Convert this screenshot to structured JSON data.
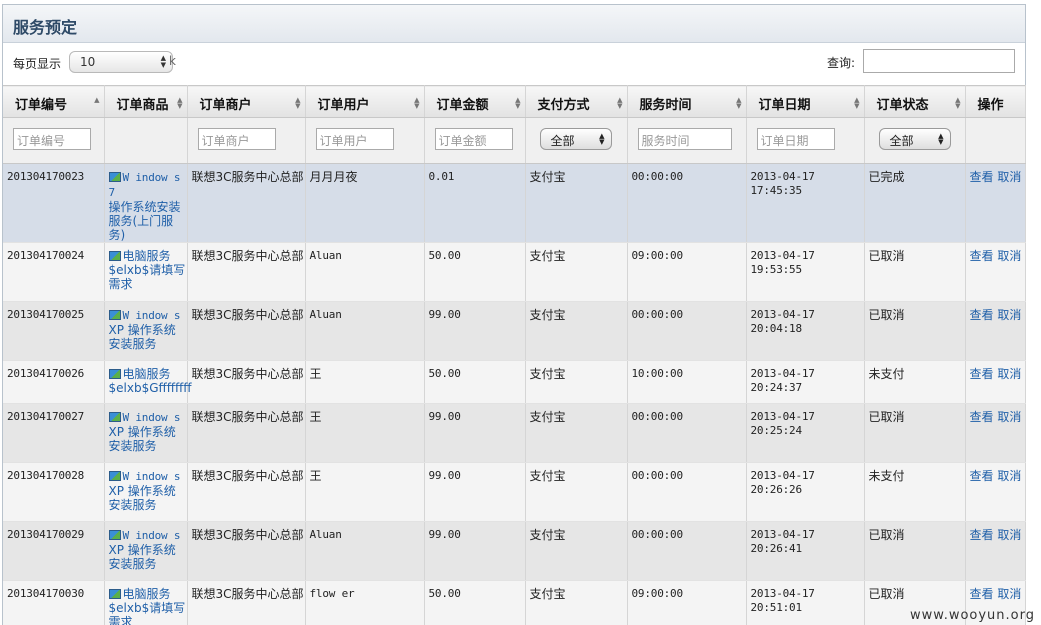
{
  "title": "服务预定",
  "toolbar": {
    "length_label": "每页显示",
    "length_value": "10",
    "length_suffix": "k",
    "search_label": "查询:"
  },
  "columns": [
    {
      "label": "订单编号",
      "filter_placeholder": "订单编号",
      "filter_type": "input"
    },
    {
      "label": "订单商品",
      "filter_placeholder": "",
      "filter_type": "none"
    },
    {
      "label": "订单商户",
      "filter_placeholder": "订单商户",
      "filter_type": "input"
    },
    {
      "label": "订单用户",
      "filter_placeholder": "订单用户",
      "filter_type": "input"
    },
    {
      "label": "订单金额",
      "filter_placeholder": "订单金额",
      "filter_type": "input"
    },
    {
      "label": "支付方式",
      "filter_placeholder": "全部",
      "filter_type": "select"
    },
    {
      "label": "服务时间",
      "filter_placeholder": "服务时间",
      "filter_type": "input"
    },
    {
      "label": "订单日期",
      "filter_placeholder": "订单日期",
      "filter_type": "input"
    },
    {
      "label": "订单状态",
      "filter_placeholder": "全部",
      "filter_type": "select"
    },
    {
      "label": "操作",
      "filter_placeholder": "",
      "filter_type": "none"
    }
  ],
  "rows": [
    {
      "id": "201304170023",
      "product_line1": "W indow s 7",
      "product_rest": "操作系统安装服务(上门服务)",
      "merchant": "联想3C服务中心总部",
      "user": "月月月夜",
      "amount": "0.01",
      "payment": "支付宝",
      "service_time": "00:00:00",
      "date": "2013-04-17",
      "time": "17:45:35",
      "status": "已完成",
      "view": "查看",
      "cancel": "取消"
    },
    {
      "id": "201304170024",
      "product_line1": "电脑服务",
      "product_rest": "$elxb$请填写需求",
      "merchant": "联想3C服务中心总部",
      "user": "Aluan",
      "amount": "50.00",
      "payment": "支付宝",
      "service_time": "09:00:00",
      "date": "2013-04-17",
      "time": "19:53:55",
      "status": "已取消",
      "view": "查看",
      "cancel": "取消"
    },
    {
      "id": "201304170025",
      "product_line1": "W indow s",
      "product_rest": "XP 操作系统安装服务",
      "merchant": "联想3C服务中心总部",
      "user": "Aluan",
      "amount": "99.00",
      "payment": "支付宝",
      "service_time": "00:00:00",
      "date": "2013-04-17",
      "time": "20:04:18",
      "status": "已取消",
      "view": "查看",
      "cancel": "取消"
    },
    {
      "id": "201304170026",
      "product_line1": "电脑服务",
      "product_rest": "$elxb$Gffffffff",
      "merchant": "联想3C服务中心总部",
      "user": "王",
      "amount": "50.00",
      "payment": "支付宝",
      "service_time": "10:00:00",
      "date": "2013-04-17",
      "time": "20:24:37",
      "status": "未支付",
      "view": "查看",
      "cancel": "取消"
    },
    {
      "id": "201304170027",
      "product_line1": "W indow s",
      "product_rest": "XP 操作系统安装服务",
      "merchant": "联想3C服务中心总部",
      "user": "王",
      "amount": "99.00",
      "payment": "支付宝",
      "service_time": "00:00:00",
      "date": "2013-04-17",
      "time": "20:25:24",
      "status": "已取消",
      "view": "查看",
      "cancel": "取消"
    },
    {
      "id": "201304170028",
      "product_line1": "W indow s",
      "product_rest": "XP 操作系统安装服务",
      "merchant": "联想3C服务中心总部",
      "user": "王",
      "amount": "99.00",
      "payment": "支付宝",
      "service_time": "00:00:00",
      "date": "2013-04-17",
      "time": "20:26:26",
      "status": "未支付",
      "view": "查看",
      "cancel": "取消"
    },
    {
      "id": "201304170029",
      "product_line1": "W indow s",
      "product_rest": "XP 操作系统安装服务",
      "merchant": "联想3C服务中心总部",
      "user": "Aluan",
      "amount": "99.00",
      "payment": "支付宝",
      "service_time": "00:00:00",
      "date": "2013-04-17",
      "time": "20:26:41",
      "status": "已取消",
      "view": "查看",
      "cancel": "取消"
    },
    {
      "id": "201304170030",
      "product_line1": "电脑服务",
      "product_rest": "$elxb$请填写需求",
      "merchant": "联想3C服务中心总部",
      "user": "flow er",
      "amount": "50.00",
      "payment": "支付宝",
      "service_time": "09:00:00",
      "date": "2013-04-17",
      "time": "20:51:01",
      "status": "已取消",
      "view": "查看",
      "cancel": "取消"
    }
  ],
  "watermark": "www.wooyun.org"
}
